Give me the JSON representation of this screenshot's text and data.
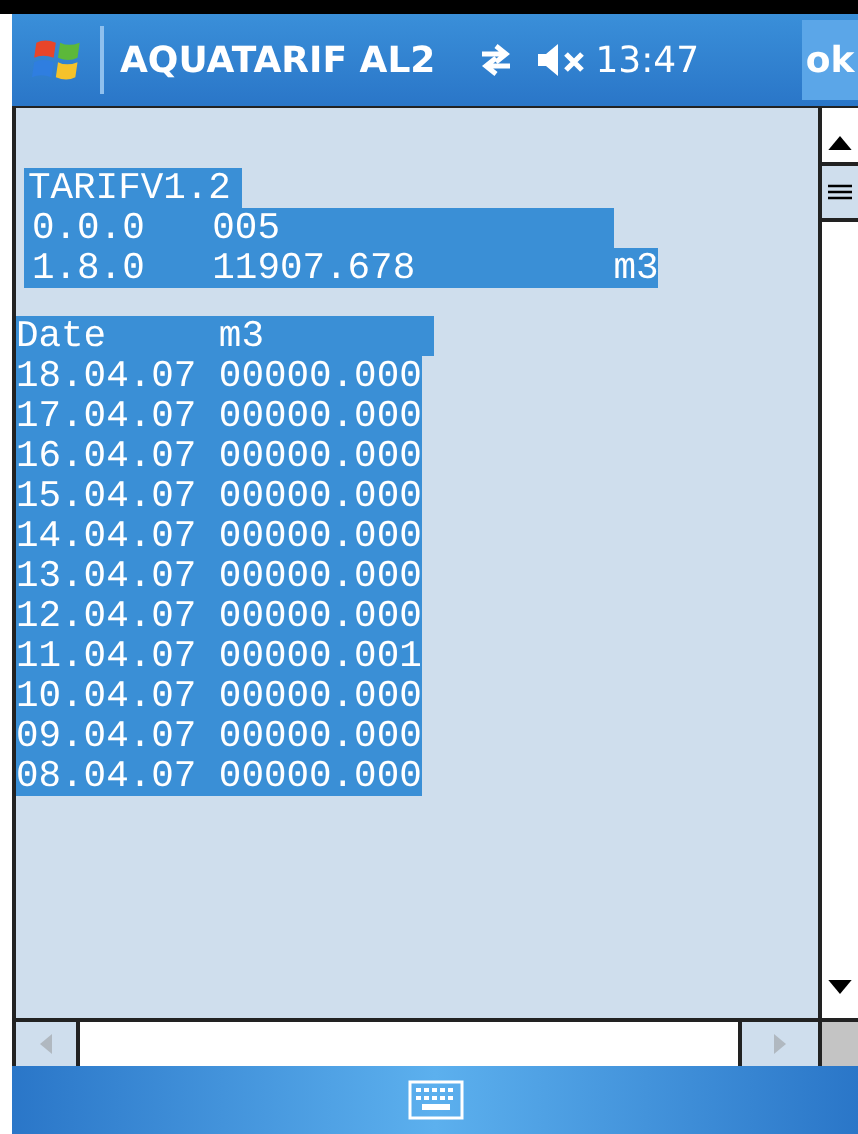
{
  "title_bar": {
    "title": "AQUATARIF AL2",
    "time": "13:47",
    "ok_button": "ok",
    "sound_muted": true
  },
  "header_lines": [
    {
      "cells": [
        "TARIFV1.2"
      ],
      "selected": true
    },
    {
      "cells": [
        "0.0.0",
        "005"
      ],
      "selected": true
    },
    {
      "cells": [
        "1.8.0",
        "11907.678",
        "m3"
      ],
      "selected": true
    }
  ],
  "table": {
    "columns": [
      "Date",
      "m3"
    ],
    "selected": true,
    "rows": [
      {
        "date": "18.04.07",
        "value": "00000.000",
        "selected": true
      },
      {
        "date": "17.04.07",
        "value": "00000.000",
        "selected": true
      },
      {
        "date": "16.04.07",
        "value": "00000.000",
        "selected": true
      },
      {
        "date": "15.04.07",
        "value": "00000.000",
        "selected": true
      },
      {
        "date": "14.04.07",
        "value": "00000.000",
        "selected": true
      },
      {
        "date": "13.04.07",
        "value": "00000.000",
        "selected": true
      },
      {
        "date": "12.04.07",
        "value": "00000.000",
        "selected": true
      },
      {
        "date": "11.04.07",
        "value": "00000.001",
        "selected": true
      },
      {
        "date": "10.04.07",
        "value": "00000.000",
        "selected": true
      },
      {
        "date": "09.04.07",
        "value": "00000.000",
        "selected": true
      },
      {
        "date": "08.04.07",
        "value": "00000.000",
        "selected": true
      }
    ]
  }
}
